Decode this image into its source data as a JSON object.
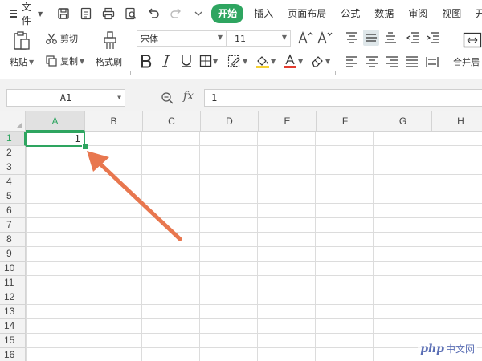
{
  "menu": {
    "file_label": "文件",
    "tabs": [
      {
        "label": "开始",
        "active": true
      },
      {
        "label": "插入",
        "active": false
      },
      {
        "label": "页面布局",
        "active": false
      },
      {
        "label": "公式",
        "active": false
      },
      {
        "label": "数据",
        "active": false
      },
      {
        "label": "审阅",
        "active": false
      },
      {
        "label": "视图",
        "active": false
      },
      {
        "label": "开发",
        "active": false
      }
    ]
  },
  "ribbon": {
    "paste_label": "粘贴",
    "cut_label": "剪切",
    "copy_label": "复制",
    "format_painter_label": "格式刷",
    "font_name": "宋体",
    "font_size": "11",
    "merge_label": "合并居"
  },
  "formula_bar": {
    "name_box": "A1",
    "fx_label": "fx",
    "formula_value": "1"
  },
  "sheet": {
    "columns": [
      "A",
      "B",
      "C",
      "D",
      "E",
      "F",
      "G",
      "H"
    ],
    "rows": [
      "1",
      "2",
      "3",
      "4",
      "5",
      "6",
      "7",
      "8",
      "9",
      "10",
      "11",
      "12",
      "13",
      "14",
      "15",
      "16"
    ],
    "selected_cell": "A1",
    "cell_a1_value": "1"
  },
  "watermark": {
    "php": "php",
    "cn": "中文网"
  },
  "colors": {
    "accent": "#2ea560",
    "arrow": "#e8774f"
  }
}
